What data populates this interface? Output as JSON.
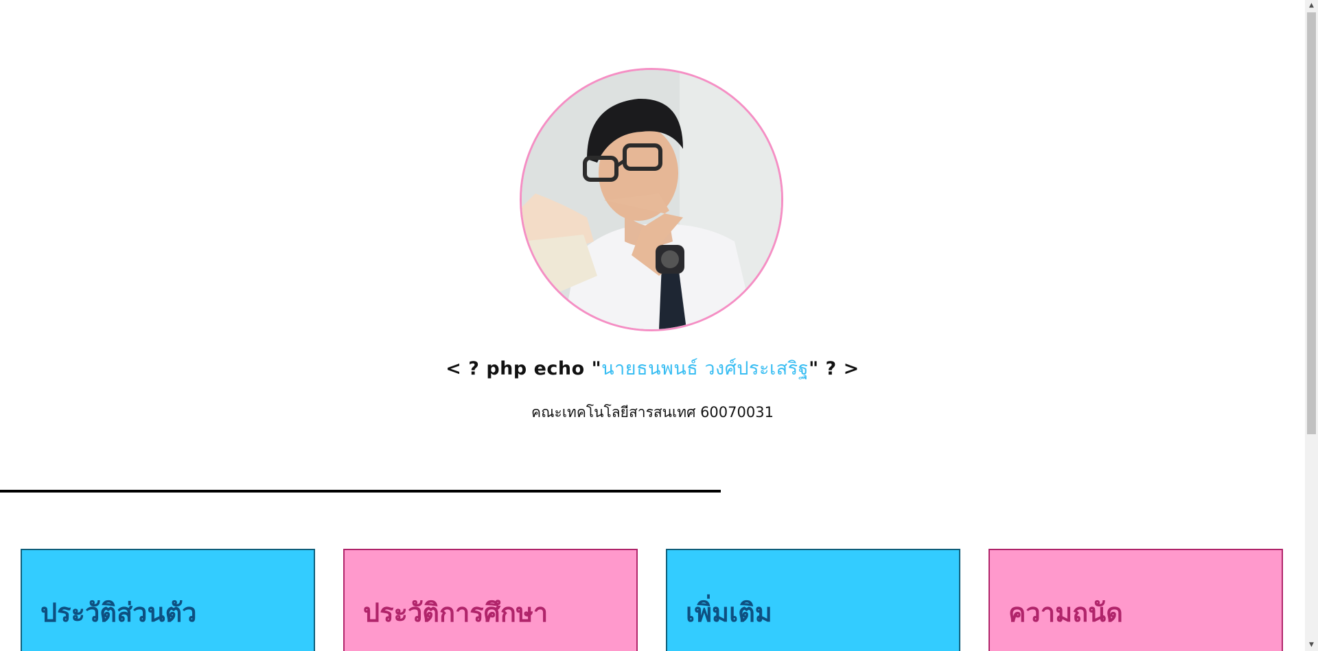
{
  "profile": {
    "avatar_alt": "profile photo",
    "name_prefix": "< ? php echo \"",
    "name": "นายธนพนธ์ วงศ์ประเสริฐ",
    "name_suffix": "\" ? >",
    "subtitle": "คณะเทคโนโลยีสารสนเทศ 60070031"
  },
  "cards": [
    {
      "title": "ประวัติส่วนตัว",
      "color": "#33ccff"
    },
    {
      "title": "ประวัติการศึกษา",
      "color": "#ff99cc"
    },
    {
      "title": "เพิ่มเติม",
      "color": "#33ccff"
    },
    {
      "title": "ความถนัด",
      "color": "#ff99cc"
    }
  ],
  "colors": {
    "accent_blue": "#38bdf2",
    "accent_pink": "#f58ec4"
  }
}
